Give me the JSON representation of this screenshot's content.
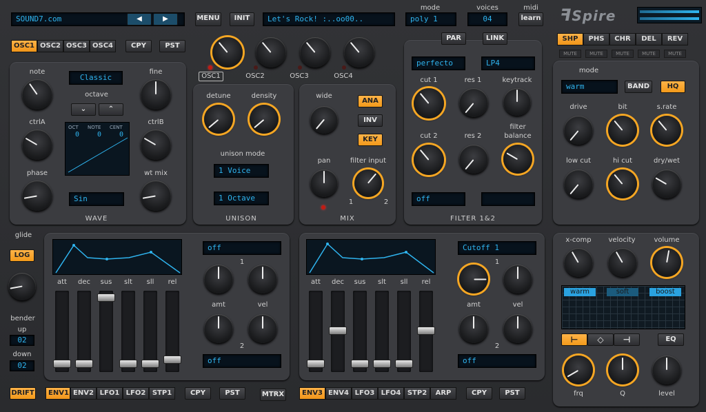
{
  "header": {
    "preset_name": "SOUND7.com",
    "preset_prev": "◀",
    "preset_next": "▶",
    "menu": "MENU",
    "init": "INIT",
    "patch_display": "Let's Rock! :..oo00..",
    "mode_label": "mode",
    "mode_value": "poly 1",
    "voices_label": "voices",
    "voices_value": "04",
    "midi_label": "midi",
    "midi_value": "learn",
    "logo": "Spire"
  },
  "osc_tabs": [
    "OSC1",
    "OSC2",
    "OSC3",
    "OSC4"
  ],
  "copy": "CPY",
  "paste": "PST",
  "osc_select": [
    "OSC1",
    "OSC2",
    "OSC3",
    "OSC4"
  ],
  "osc": {
    "note": "note",
    "fine": "fine",
    "octave": "octave",
    "ctrlA": "ctrlA",
    "ctrlB": "ctrlB",
    "phase": "phase",
    "wt_mix": "wt mix",
    "mode_value": "Classic",
    "oct_hdr": "OCT",
    "note_hdr": "NOTE",
    "cent_hdr": "CENT",
    "oct_val": "0",
    "note_val": "0",
    "cent_val": "0",
    "wave_value": "Sin",
    "title": "WAVE",
    "down": "⌄",
    "up": "⌃"
  },
  "unison": {
    "detune": "detune",
    "density": "density",
    "mode_label": "unison mode",
    "voices": "1 Voice",
    "octave": "1 Octave",
    "title": "UNISON"
  },
  "mix": {
    "wide": "wide",
    "pan": "pan",
    "filter_input": "filter input",
    "ana": "ANA",
    "inv": "INV",
    "key": "KEY",
    "in1": "1",
    "in2": "2",
    "title": "MIX"
  },
  "filter": {
    "par": "PAR",
    "link": "LINK",
    "type1": "perfecto",
    "type2": "LP4",
    "cut1": "cut 1",
    "res1": "res 1",
    "keytrack": "keytrack",
    "cut2": "cut 2",
    "res2": "res 2",
    "balance": "filter balance",
    "mod": "off",
    "mod2": "",
    "title": "FILTER 1&2"
  },
  "fx_tabs": [
    "SHP",
    "PHS",
    "CHR",
    "DEL",
    "REV"
  ],
  "fx_mutes": [
    "MUTE",
    "MUTE",
    "MUTE",
    "MUTE",
    "MUTE"
  ],
  "shaper": {
    "mode_label": "mode",
    "mode_value": "warm",
    "band": "BAND",
    "hq": "HQ",
    "drive": "drive",
    "bit": "bit",
    "srate": "s.rate",
    "lowcut": "low cut",
    "hicut": "hi cut",
    "drywet": "dry/wet"
  },
  "master": {
    "xcomp": "x-comp",
    "velocity": "velocity",
    "volume": "volume",
    "warm": "warm",
    "soft": "soft",
    "boost": "boost",
    "eq": "EQ",
    "frq": "frq",
    "q": "Q",
    "level": "level"
  },
  "glide": {
    "label": "glide",
    "log": "LOG",
    "bender": "bender",
    "up": "up",
    "up_value": "02",
    "down": "down",
    "down_value": "02",
    "drift": "DRIFT"
  },
  "env_left": {
    "labels": [
      "att",
      "dec",
      "sus",
      "slt",
      "sll",
      "rel"
    ],
    "mod1": "off",
    "mod2": "off",
    "amt": "amt",
    "vel": "vel",
    "n1": "1",
    "n2": "2",
    "tabs": [
      "ENV1",
      "ENV2",
      "LFO1",
      "LFO2",
      "STP1"
    ]
  },
  "env_right": {
    "labels": [
      "att",
      "dec",
      "sus",
      "slt",
      "sll",
      "rel"
    ],
    "mod1": "Cutoff 1",
    "mod2": "off",
    "amt": "amt",
    "vel": "vel",
    "n1": "1",
    "n2": "2",
    "tabs": [
      "ENV3",
      "ENV4",
      "LFO3",
      "LFO4",
      "STP2",
      "ARP"
    ]
  },
  "mtrx": "MTRX",
  "colors": {
    "accent": "#f5a623",
    "lcd": "#2fb4ef"
  }
}
